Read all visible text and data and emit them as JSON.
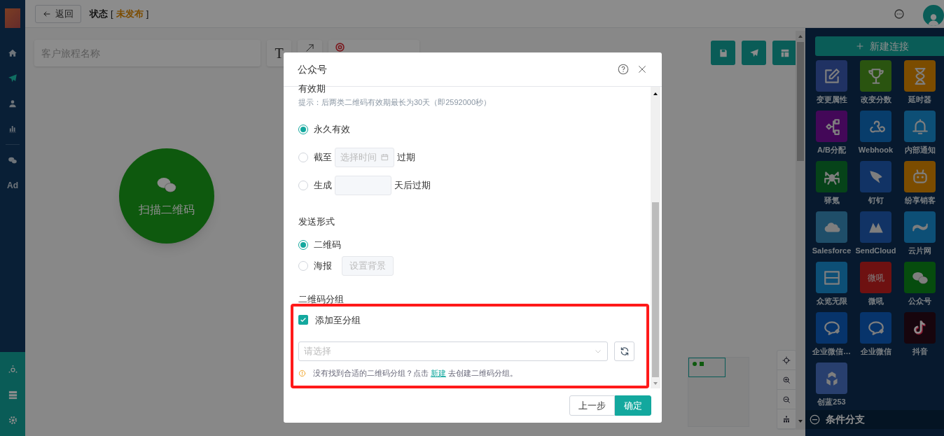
{
  "header": {
    "back_button": "返回",
    "status_label": "状态",
    "status_brackets": [
      "[",
      "]"
    ],
    "status_value": "未发布"
  },
  "left_nav": {
    "items": [
      {
        "kind": "icon",
        "selected": false
      },
      {
        "kind": "icon",
        "selected": true
      },
      {
        "kind": "icon",
        "selected": false
      },
      {
        "kind": "icon",
        "selected": false
      },
      {
        "kind": "icon",
        "selected": false
      },
      {
        "kind": "text",
        "label": "Ad",
        "selected": false
      }
    ]
  },
  "toolbar": {
    "name_placeholder": "客户旅程名称",
    "text_tool": "T"
  },
  "canvas": {
    "node": {
      "label": "扫描二维码"
    }
  },
  "right_panel": {
    "new_connection": "新建连接",
    "items": [
      {
        "label": "变更属性",
        "kind": "icon"
      },
      {
        "label": "改变分数",
        "kind": "icon"
      },
      {
        "label": "延时器",
        "kind": "icon"
      },
      {
        "label": "A/B分配",
        "kind": "icon"
      },
      {
        "label": "Webhook",
        "kind": "icon"
      },
      {
        "label": "内部通知",
        "kind": "icon"
      },
      {
        "label": "驿氪",
        "kind": "icon"
      },
      {
        "label": "钉钉",
        "kind": "icon"
      },
      {
        "label": "纷享销客",
        "kind": "icon"
      },
      {
        "label": "Salesforce",
        "kind": "icon"
      },
      {
        "label": "SendCloud",
        "kind": "icon"
      },
      {
        "label": "云片网",
        "kind": "icon"
      },
      {
        "label": "众览无限",
        "kind": "icon"
      },
      {
        "label": "微吼",
        "kind": "text"
      },
      {
        "label": "公众号",
        "kind": "icon"
      },
      {
        "label": "企业微信…",
        "kind": "icon"
      },
      {
        "label": "企业微信",
        "kind": "icon"
      },
      {
        "label": "抖音",
        "kind": "icon"
      },
      {
        "label": "创蓝253",
        "kind": "icon"
      }
    ],
    "tile_texts": [
      "微吼"
    ],
    "section": "条件分支"
  },
  "dialog": {
    "title": "公众号",
    "validity": {
      "heading": "有效期",
      "hint": "提示：后两类二维码有效期最长为30天（即2592000秒）",
      "options": [
        {
          "kind": "plain",
          "label": "永久有效",
          "selected": true
        },
        {
          "kind": "date",
          "label": "截至",
          "placeholder": "选择时间",
          "suffix": "过期",
          "selected": false
        },
        {
          "kind": "days",
          "label": "生成",
          "suffix": "天后过期",
          "selected": false
        }
      ]
    },
    "send_form": {
      "heading": "发送形式",
      "options": [
        {
          "kind": "plain",
          "label": "二维码",
          "selected": true
        },
        {
          "kind": "button",
          "label": "海报",
          "button": "设置背景",
          "selected": false
        }
      ]
    },
    "group": {
      "heading": "二维码分组",
      "checkbox": {
        "label": "添加至分组",
        "checked": true
      },
      "select_placeholder": "请选择",
      "tip": "没有找到合适的二维码分组？点击",
      "tip_link": "新建",
      "tip_after": "去创建二维码分组。"
    },
    "buttons": [
      {
        "label": "上一步",
        "kind": "secondary"
      },
      {
        "label": "确定",
        "kind": "primary"
      }
    ]
  }
}
